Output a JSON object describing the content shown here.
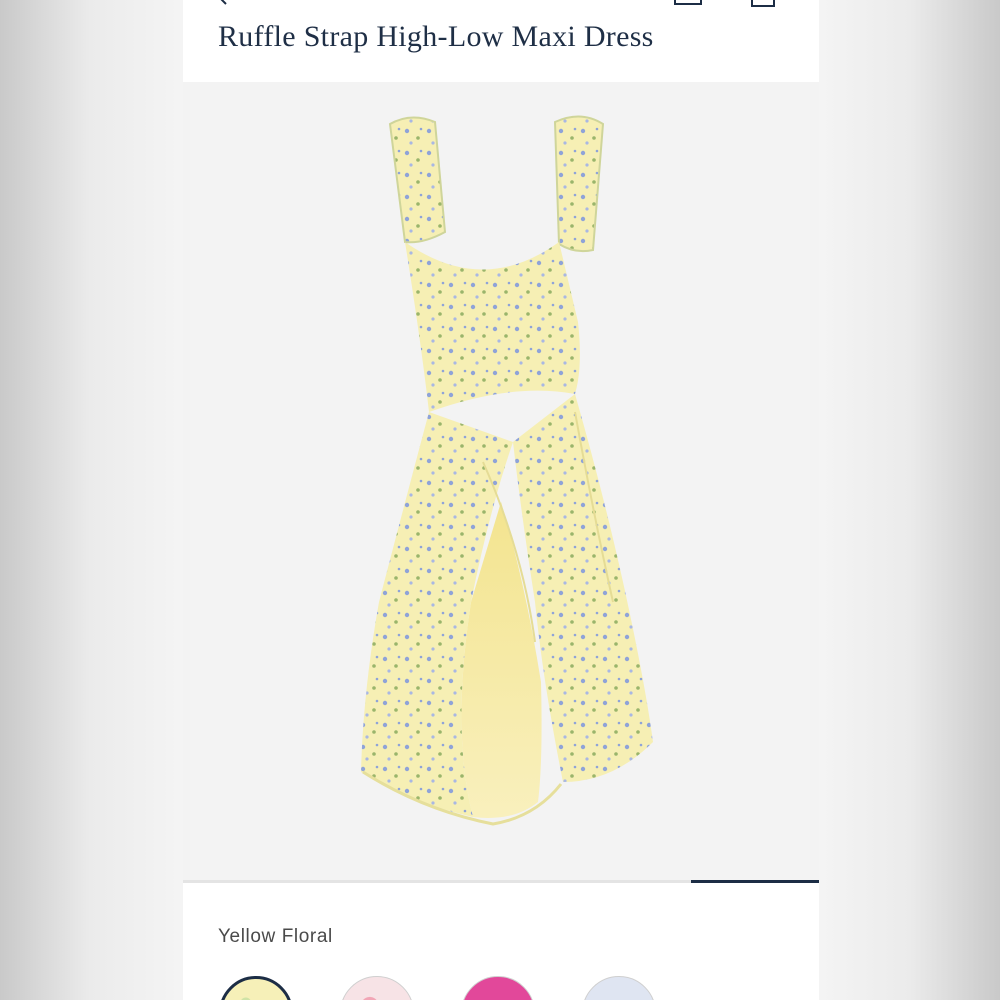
{
  "product": {
    "title": "Ruffle Strap High-Low Maxi Dress",
    "color_name": "Yellow Floral"
  },
  "header": {
    "back_icon": "chevron-left-icon",
    "save_icon": "save-icon",
    "bag_icon": "shopping-bag-icon"
  },
  "carousel": {
    "position": 5,
    "count": 5
  },
  "swatches": [
    {
      "name": "swatch-yellow-floral",
      "color": "#f6f0b8",
      "selected": true
    },
    {
      "name": "swatch-pink-floral",
      "color": "#f7e3e6",
      "selected": false
    },
    {
      "name": "swatch-pink",
      "color": "#e2489a",
      "selected": false
    },
    {
      "name": "swatch-blue-floral",
      "color": "#dfe5f2",
      "selected": false
    }
  ],
  "colors": {
    "navy": "#1c2d45",
    "dress_yellow": "#f6efb4",
    "print_blue": "#8fa3d8"
  }
}
